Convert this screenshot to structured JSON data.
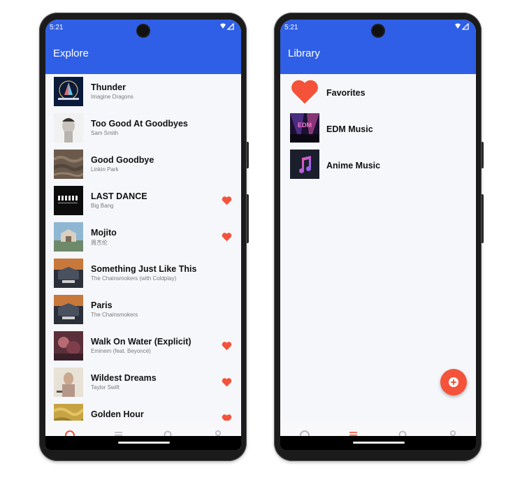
{
  "colors": {
    "primary": "#2f5fe6",
    "accent": "#f4533a",
    "nav_inactive": "#b7b7bf",
    "background": "#f6f7fb"
  },
  "explore_screen": {
    "status_time": "5:21",
    "title": "Explore",
    "songs": [
      {
        "title": "Thunder",
        "artist": "Imagine Dragons",
        "favorited": false
      },
      {
        "title": "Too Good At Goodbyes",
        "artist": "Sam Smith",
        "favorited": false
      },
      {
        "title": "Good Goodbye",
        "artist": "Linkin Park",
        "favorited": false
      },
      {
        "title": "LAST DANCE",
        "artist": "Big Bang",
        "favorited": true
      },
      {
        "title": "Mojito",
        "artist": "周杰伦",
        "favorited": true
      },
      {
        "title": "Something Just Like This",
        "artist": "The Chainsmokers (with Coldplay)",
        "favorited": false
      },
      {
        "title": "Paris",
        "artist": "The Chainsmokers",
        "favorited": false
      },
      {
        "title": "Walk On Water (Explicit)",
        "artist": "Eminem (feat. Beyoncé)",
        "favorited": true
      },
      {
        "title": "Wildest Dreams",
        "artist": "Taylor Swift",
        "favorited": true
      },
      {
        "title": "Golden Hour",
        "artist": "",
        "favorited": true
      }
    ],
    "nav": {
      "active": "headphones",
      "items": [
        "headphones-icon",
        "playlist-icon",
        "search-icon",
        "person-icon"
      ]
    }
  },
  "library_screen": {
    "status_time": "5:21",
    "title": "Library",
    "playlists": [
      {
        "title": "Favorites",
        "icon": "heart-icon"
      },
      {
        "title": "EDM Music",
        "icon": "edm-cover"
      },
      {
        "title": "Anime Music",
        "icon": "music-note-cover"
      }
    ],
    "fab_icon": "add-icon",
    "nav": {
      "active": "playlist",
      "items": [
        "headphones-icon",
        "playlist-icon",
        "search-icon",
        "person-icon"
      ]
    }
  }
}
